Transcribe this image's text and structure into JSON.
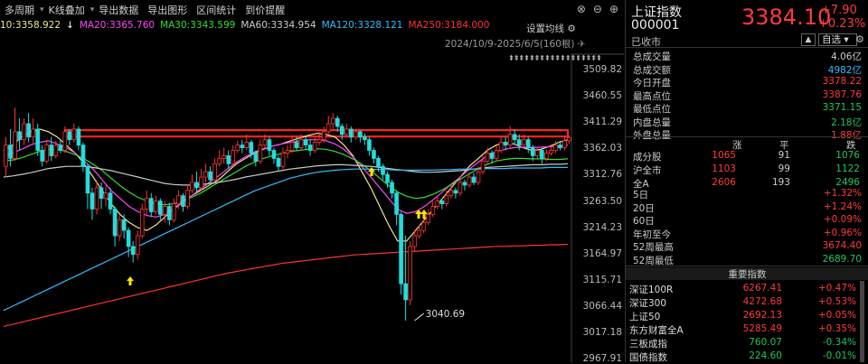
{
  "toolbar": {
    "items": [
      "多周期",
      "K线叠加",
      "导出数据",
      "导出图形",
      "区间统计",
      "到价提醒"
    ],
    "has_caret": [
      true,
      true,
      false,
      false,
      false,
      false
    ]
  },
  "ma_legend": [
    {
      "text": "10:3358.922",
      "color": "#f0e68c"
    },
    {
      "text": "MA20:3365.760",
      "color": "#ff44ff"
    },
    {
      "text": "MA30:3343.599",
      "color": "#33dd33"
    },
    {
      "text": "MA60:3334.954",
      "color": "#cccccc"
    },
    {
      "text": "MA120:3328.121",
      "color": "#33bbff"
    },
    {
      "text": "MA250:3184.000",
      "color": "#ff3333"
    }
  ],
  "ma_down_arrow": "↓",
  "settings_label": "设置均线",
  "date_range": "2024/10/9-2025/6/5(160根)",
  "arrows_row": "⇞⇞⇞⇞⇞⇞⇞⇞⇞⇞⇞⇞⇞⇞⇞⇞⇞⇞",
  "chart_data": {
    "type": "candlestick",
    "y_ticks": [
      "3509.82",
      "3460.55",
      "3411.29",
      "3362.03",
      "3312.76",
      "3263.50",
      "3214.23",
      "3164.97",
      "3115.71",
      "3066.44",
      "3017.18",
      "2967.91"
    ],
    "ylim": [
      2967.91,
      3509.82
    ],
    "low_annotation": "3040.69",
    "resistance_band": [
      3386,
      3398
    ],
    "candles": [
      [
        3330,
        3370,
        3310,
        3385
      ],
      [
        3370,
        3345,
        3330,
        3400
      ],
      [
        3345,
        3395,
        3340,
        3440
      ],
      [
        3395,
        3380,
        3360,
        3420
      ],
      [
        3380,
        3410,
        3370,
        3420
      ],
      [
        3410,
        3385,
        3375,
        3430
      ],
      [
        3385,
        3400,
        3370,
        3420
      ],
      [
        3400,
        3360,
        3350,
        3410
      ],
      [
        3360,
        3340,
        3330,
        3370
      ],
      [
        3340,
        3370,
        3335,
        3380
      ],
      [
        3370,
        3350,
        3340,
        3385
      ],
      [
        3350,
        3370,
        3345,
        3378
      ],
      [
        3370,
        3360,
        3355,
        3380
      ],
      [
        3360,
        3395,
        3355,
        3405
      ],
      [
        3395,
        3380,
        3370,
        3400
      ],
      [
        3380,
        3400,
        3375,
        3410
      ],
      [
        3400,
        3370,
        3360,
        3405
      ],
      [
        3370,
        3330,
        3320,
        3375
      ],
      [
        3330,
        3280,
        3250,
        3335
      ],
      [
        3280,
        3250,
        3230,
        3290
      ],
      [
        3250,
        3290,
        3240,
        3300
      ],
      [
        3290,
        3270,
        3250,
        3300
      ],
      [
        3270,
        3280,
        3255,
        3295
      ],
      [
        3280,
        3250,
        3240,
        3290
      ],
      [
        3250,
        3200,
        3180,
        3255
      ],
      [
        3200,
        3230,
        3190,
        3240
      ],
      [
        3230,
        3210,
        3195,
        3240
      ],
      [
        3210,
        3180,
        3160,
        3215
      ],
      [
        3180,
        3165,
        3150,
        3190
      ],
      [
        3165,
        3200,
        3155,
        3210
      ],
      [
        3200,
        3250,
        3195,
        3260
      ],
      [
        3250,
        3270,
        3240,
        3285
      ],
      [
        3270,
        3245,
        3235,
        3280
      ],
      [
        3245,
        3265,
        3240,
        3275
      ],
      [
        3265,
        3240,
        3230,
        3270
      ],
      [
        3240,
        3255,
        3225,
        3265
      ],
      [
        3255,
        3230,
        3220,
        3262
      ],
      [
        3230,
        3260,
        3225,
        3270
      ],
      [
        3260,
        3275,
        3250,
        3285
      ],
      [
        3275,
        3255,
        3245,
        3280
      ],
      [
        3255,
        3285,
        3250,
        3295
      ],
      [
        3285,
        3300,
        3280,
        3315
      ],
      [
        3300,
        3290,
        3280,
        3320
      ],
      [
        3290,
        3310,
        3285,
        3325
      ],
      [
        3310,
        3320,
        3300,
        3335
      ],
      [
        3320,
        3305,
        3295,
        3330
      ],
      [
        3305,
        3335,
        3300,
        3345
      ],
      [
        3335,
        3345,
        3330,
        3360
      ],
      [
        3345,
        3350,
        3335,
        3365
      ],
      [
        3350,
        3335,
        3325,
        3360
      ],
      [
        3335,
        3360,
        3330,
        3370
      ],
      [
        3360,
        3370,
        3355,
        3378
      ],
      [
        3370,
        3365,
        3355,
        3380
      ],
      [
        3365,
        3375,
        3360,
        3390
      ],
      [
        3375,
        3355,
        3345,
        3380
      ],
      [
        3355,
        3340,
        3330,
        3360
      ],
      [
        3340,
        3370,
        3335,
        3380
      ],
      [
        3370,
        3380,
        3365,
        3390
      ],
      [
        3380,
        3360,
        3350,
        3385
      ],
      [
        3360,
        3345,
        3335,
        3365
      ],
      [
        3345,
        3330,
        3320,
        3350
      ],
      [
        3330,
        3355,
        3325,
        3365
      ],
      [
        3355,
        3360,
        3345,
        3370
      ],
      [
        3360,
        3375,
        3355,
        3385
      ],
      [
        3375,
        3365,
        3360,
        3385
      ],
      [
        3365,
        3380,
        3360,
        3390
      ],
      [
        3380,
        3370,
        3360,
        3385
      ],
      [
        3370,
        3360,
        3350,
        3380
      ],
      [
        3360,
        3375,
        3355,
        3385
      ],
      [
        3375,
        3380,
        3370,
        3395
      ],
      [
        3380,
        3395,
        3375,
        3405
      ],
      [
        3395,
        3410,
        3390,
        3425
      ],
      [
        3410,
        3420,
        3400,
        3430
      ],
      [
        3420,
        3405,
        3395,
        3425
      ],
      [
        3405,
        3390,
        3380,
        3410
      ],
      [
        3390,
        3400,
        3385,
        3410
      ],
      [
        3400,
        3385,
        3375,
        3405
      ],
      [
        3385,
        3395,
        3380,
        3400
      ],
      [
        3395,
        3385,
        3375,
        3398
      ],
      [
        3385,
        3380,
        3370,
        3392
      ],
      [
        3380,
        3360,
        3350,
        3385
      ],
      [
        3360,
        3345,
        3335,
        3365
      ],
      [
        3345,
        3330,
        3320,
        3350
      ],
      [
        3330,
        3315,
        3305,
        3335
      ],
      [
        3315,
        3300,
        3290,
        3320
      ],
      [
        3300,
        3280,
        3270,
        3305
      ],
      [
        3280,
        3240,
        3220,
        3285
      ],
      [
        3240,
        3110,
        3090,
        3245
      ],
      [
        3110,
        3080,
        3041,
        3200
      ],
      [
        3080,
        3180,
        3070,
        3190
      ],
      [
        3180,
        3200,
        3170,
        3210
      ],
      [
        3200,
        3210,
        3195,
        3220
      ],
      [
        3210,
        3225,
        3205,
        3235
      ],
      [
        3225,
        3240,
        3220,
        3250
      ],
      [
        3240,
        3255,
        3235,
        3265
      ],
      [
        3255,
        3265,
        3250,
        3275
      ],
      [
        3265,
        3260,
        3250,
        3270
      ],
      [
        3260,
        3275,
        3255,
        3285
      ],
      [
        3275,
        3285,
        3270,
        3295
      ],
      [
        3285,
        3280,
        3270,
        3290
      ],
      [
        3280,
        3300,
        3275,
        3310
      ],
      [
        3300,
        3295,
        3285,
        3305
      ],
      [
        3295,
        3310,
        3290,
        3320
      ],
      [
        3310,
        3300,
        3295,
        3318
      ],
      [
        3300,
        3320,
        3295,
        3330
      ],
      [
        3320,
        3340,
        3315,
        3350
      ],
      [
        3340,
        3355,
        3335,
        3365
      ],
      [
        3355,
        3345,
        3335,
        3360
      ],
      [
        3345,
        3360,
        3340,
        3370
      ],
      [
        3360,
        3375,
        3355,
        3385
      ],
      [
        3375,
        3370,
        3360,
        3385
      ],
      [
        3370,
        3390,
        3365,
        3405
      ],
      [
        3390,
        3380,
        3370,
        3400
      ],
      [
        3380,
        3370,
        3360,
        3390
      ],
      [
        3370,
        3380,
        3365,
        3390
      ],
      [
        3380,
        3365,
        3355,
        3385
      ],
      [
        3365,
        3350,
        3340,
        3370
      ],
      [
        3350,
        3360,
        3345,
        3365
      ],
      [
        3360,
        3345,
        3335,
        3365
      ],
      [
        3345,
        3355,
        3340,
        3362
      ],
      [
        3355,
        3360,
        3350,
        3368
      ],
      [
        3360,
        3370,
        3355,
        3378
      ],
      [
        3370,
        3365,
        3360,
        3378
      ],
      [
        3365,
        3378,
        3360,
        3385
      ],
      [
        3378,
        3384,
        3372,
        3388
      ]
    ],
    "ma_lines": [
      {
        "name": "MA10",
        "color": "#f0e68c",
        "values": [
          3360,
          3370,
          3385,
          3395,
          3400,
          3395,
          3385,
          3370,
          3355,
          3335,
          3310,
          3285,
          3260,
          3240,
          3225,
          3215,
          3210,
          3220,
          3235,
          3250,
          3265,
          3275,
          3285,
          3295,
          3305,
          3320,
          3335,
          3345,
          3355,
          3362,
          3368,
          3372,
          3378,
          3383,
          3388,
          3392,
          3390,
          3385,
          3370,
          3350,
          3320,
          3290,
          3255,
          3220,
          3190,
          3190,
          3210,
          3230,
          3250,
          3270,
          3290,
          3310,
          3330,
          3345,
          3360,
          3370,
          3375,
          3372,
          3365,
          3360,
          3362,
          3368,
          3375,
          3380
        ]
      },
      {
        "name": "MA20",
        "color": "#ff44ff",
        "values": [
          3350,
          3355,
          3362,
          3370,
          3375,
          3378,
          3372,
          3365,
          3355,
          3340,
          3325,
          3305,
          3285,
          3270,
          3255,
          3245,
          3238,
          3235,
          3240,
          3250,
          3262,
          3275,
          3288,
          3300,
          3312,
          3325,
          3338,
          3348,
          3357,
          3363,
          3368,
          3372,
          3375,
          3378,
          3380,
          3380,
          3378,
          3372,
          3362,
          3348,
          3330,
          3310,
          3290,
          3270,
          3250,
          3242,
          3245,
          3255,
          3268,
          3282,
          3297,
          3310,
          3325,
          3338,
          3350,
          3358,
          3362,
          3365,
          3366,
          3366,
          3366,
          3367,
          3368,
          3370
        ]
      },
      {
        "name": "MA30",
        "color": "#33dd33",
        "values": [
          3340,
          3342,
          3346,
          3352,
          3358,
          3362,
          3362,
          3358,
          3352,
          3344,
          3334,
          3322,
          3308,
          3294,
          3282,
          3272,
          3265,
          3260,
          3258,
          3260,
          3265,
          3272,
          3280,
          3290,
          3300,
          3310,
          3320,
          3330,
          3338,
          3345,
          3350,
          3354,
          3358,
          3360,
          3362,
          3363,
          3362,
          3358,
          3352,
          3344,
          3334,
          3322,
          3308,
          3294,
          3282,
          3274,
          3270,
          3272,
          3278,
          3286,
          3296,
          3306,
          3316,
          3326,
          3334,
          3340,
          3343,
          3345,
          3345,
          3344,
          3344,
          3343,
          3343,
          3344
        ]
      },
      {
        "name": "MA60",
        "color": "#cccccc",
        "values": [
          3310,
          3312,
          3315,
          3318,
          3322,
          3326,
          3328,
          3330,
          3330,
          3330,
          3328,
          3325,
          3322,
          3318,
          3314,
          3310,
          3306,
          3302,
          3298,
          3296,
          3295,
          3295,
          3296,
          3298,
          3300,
          3303,
          3306,
          3310,
          3313,
          3316,
          3319,
          3322,
          3325,
          3327,
          3329,
          3331,
          3332,
          3333,
          3333,
          3332,
          3331,
          3330,
          3328,
          3326,
          3324,
          3322,
          3320,
          3319,
          3319,
          3320,
          3321,
          3322,
          3324,
          3326,
          3328,
          3329,
          3330,
          3331,
          3332,
          3333,
          3333,
          3334,
          3334,
          3335
        ]
      },
      {
        "name": "MA120",
        "color": "#33bbff",
        "values": [
          3060,
          3068,
          3076,
          3084,
          3092,
          3100,
          3108,
          3116,
          3124,
          3132,
          3140,
          3148,
          3156,
          3164,
          3172,
          3180,
          3188,
          3196,
          3204,
          3212,
          3220,
          3228,
          3236,
          3244,
          3252,
          3260,
          3268,
          3276,
          3284,
          3290,
          3296,
          3302,
          3308,
          3312,
          3316,
          3319,
          3321,
          3323,
          3324,
          3325,
          3325,
          3325,
          3324,
          3324,
          3323,
          3323,
          3323,
          3323,
          3323,
          3324,
          3324,
          3325,
          3325,
          3325,
          3326,
          3326,
          3326,
          3327,
          3327,
          3327,
          3327,
          3328,
          3328,
          3328
        ]
      },
      {
        "name": "MA250",
        "color": "#ff3333",
        "values": [
          3030,
          3034,
          3038,
          3042,
          3046,
          3050,
          3054,
          3058,
          3062,
          3066,
          3070,
          3074,
          3078,
          3082,
          3086,
          3090,
          3094,
          3098,
          3102,
          3106,
          3110,
          3114,
          3118,
          3122,
          3126,
          3130,
          3133,
          3136,
          3139,
          3142,
          3145,
          3148,
          3150,
          3152,
          3154,
          3156,
          3158,
          3160,
          3162,
          3164,
          3165,
          3166,
          3167,
          3168,
          3169,
          3170,
          3171,
          3172,
          3173,
          3174,
          3175,
          3176,
          3177,
          3178,
          3179,
          3180,
          3180,
          3181,
          3181,
          3182,
          3182,
          3183,
          3183,
          3184
        ]
      }
    ]
  },
  "quote": {
    "name": "上证指数",
    "code": "000001",
    "price": "3384.10",
    "change": "+7.90",
    "change_pct": "+0.23%",
    "status": "已收市",
    "fav_label": "自选",
    "fav_caret": "▾",
    "bell_icon": "▲",
    "gear_icon": "⚙"
  },
  "stats": [
    {
      "k": "总成交量",
      "v": "4.06亿",
      "c": "#ccc"
    },
    {
      "k": "总成交额",
      "v": "4982亿",
      "c": "#33bbff"
    },
    {
      "k": "今日开盘",
      "v": "3378.22",
      "c": "#ff3b3b"
    },
    {
      "k": "最高点位",
      "v": "3387.76",
      "c": "#ff3b3b"
    },
    {
      "k": "最低点位",
      "v": "3371.15",
      "c": "#22c55e"
    },
    {
      "k": "内盘总量",
      "v": "2.18亿",
      "c": "#22c55e"
    },
    {
      "k": "外盘总量",
      "v": "1.88亿",
      "c": "#ff3b3b"
    }
  ],
  "breadth": {
    "headers": [
      "涨",
      "平",
      "跌"
    ],
    "rows": [
      {
        "label": "成分股",
        "up": "1065",
        "flat": "91",
        "down": "1076"
      },
      {
        "label": "沪全市",
        "up": "1103",
        "flat": "99",
        "down": "1122"
      },
      {
        "label": "全A",
        "up": "2606",
        "flat": "193",
        "down": "2496"
      }
    ]
  },
  "periods": [
    {
      "k": "5日",
      "v": "+1.32%",
      "c": "#ff3b3b"
    },
    {
      "k": "20日",
      "v": "+1.24%",
      "c": "#ff3b3b"
    },
    {
      "k": "60日",
      "v": "+0.09%",
      "c": "#ff3b3b"
    },
    {
      "k": "年初至今",
      "v": "+0.96%",
      "c": "#ff3b3b"
    },
    {
      "k": "52周最高",
      "v": "3674.40",
      "c": "#ff3b3b"
    },
    {
      "k": "52周最低",
      "v": "2689.70",
      "c": "#22c55e"
    }
  ],
  "indices_title": "重要指数",
  "indices": [
    {
      "name": "深证100R",
      "price": "6267.41",
      "pct": "+0.47%",
      "c": "#ff3b3b"
    },
    {
      "name": "深证300",
      "price": "4272.68",
      "pct": "+0.53%",
      "c": "#ff3b3b"
    },
    {
      "name": "上证50",
      "price": "2692.13",
      "pct": "+0.05%",
      "c": "#ff3b3b"
    },
    {
      "name": "东方财富全A",
      "price": "5285.49",
      "pct": "+0.35%",
      "c": "#ff3b3b"
    },
    {
      "name": "三板成指",
      "price": "760.07",
      "pct": "-0.34%",
      "c": "#22c55e"
    },
    {
      "name": "国债指数",
      "price": "224.60",
      "pct": "-0.01%",
      "c": "#22c55e"
    }
  ],
  "icons": {
    "settings": "⚙",
    "close": "⊗",
    "restore": "⊖",
    "max": "⊕",
    "menu": "▾",
    "chevron": "⌄"
  }
}
